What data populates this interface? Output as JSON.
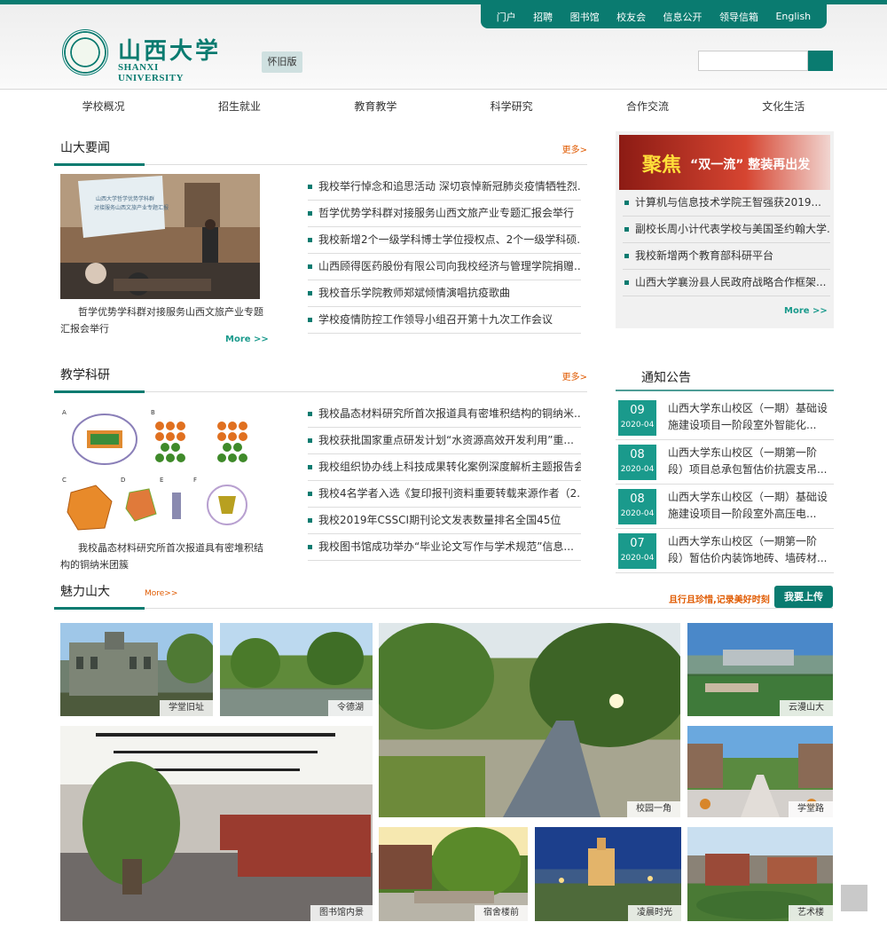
{
  "header": {
    "top_links": [
      "门户",
      "招聘",
      "图书馆",
      "校友会",
      "信息公开",
      "领导信箱",
      "English"
    ],
    "logo_cn": "山西大学",
    "logo_en": "SHANXI UNIVERSITY",
    "old_version": "怀旧版",
    "search_placeholder": ""
  },
  "nav": [
    "学校概况",
    "招生就业",
    "教育教学",
    "科学研究",
    "合作交流",
    "文化生活"
  ],
  "news": {
    "title": "山大要闻",
    "more": "更多>",
    "feature_caption": "哲学优势学科群对接服务山西文旅产业专题汇报会举行",
    "feature_more": "More >>",
    "items": [
      "我校举行悼念和追思活动 深切哀悼新冠肺炎疫情牺牲烈...",
      "哲学优势学科群对接服务山西文旅产业专题汇报会举行",
      "我校新增2个一级学科博士学位授权点、2个一级学科硕...",
      "山西顾得医药股份有限公司向我校经济与管理学院捐赠...",
      "我校音乐学院教师郑斌倾情演唱抗疫歌曲",
      "学校疫情防控工作领导小组召开第十九次工作会议"
    ]
  },
  "banner": {
    "big": "聚焦",
    "small": "“双一流” 整装再出发"
  },
  "right_news": {
    "items": [
      "计算机与信息技术学院王智强获2019...",
      "副校长周小计代表学校与美国圣约翰大学...",
      "我校新增两个教育部科研平台",
      "山西大学襄汾县人民政府战略合作框架..."
    ],
    "more": "More >>"
  },
  "research": {
    "title": "教学科研",
    "more": "更多>",
    "feature_caption": "我校晶态材料研究所首次报道具有密堆积结构的铜纳米团簇",
    "items": [
      "我校晶态材料研究所首次报道具有密堆积结构的铜纳米...",
      "我校获批国家重点研发计划“水资源高效开发利用”重...",
      "我校组织协办线上科技成果转化案例深度解析主题报告会",
      "我校4名学者入选《复印报刊资料重要转载来源作者（2...",
      "我校2019年CSSCI期刊论文发表数量排名全国45位",
      "我校图书馆成功举办“毕业论文写作与学术规范”信息..."
    ]
  },
  "notices": {
    "title": "通知公告",
    "items": [
      {
        "day": "09",
        "month": "2020-04",
        "text": "山西大学东山校区（一期）基础设施建设项目一阶段室外智能化..."
      },
      {
        "day": "08",
        "month": "2020-04",
        "text": "山西大学东山校区（一期第一阶段）项目总承包暂估价抗震支吊..."
      },
      {
        "day": "08",
        "month": "2020-04",
        "text": "山西大学东山校区（一期）基础设施建设项目一阶段室外高压电..."
      },
      {
        "day": "07",
        "month": "2020-04",
        "text": "山西大学东山校区（一期第一阶段）暂估价内装饰地砖、墙砖材..."
      }
    ]
  },
  "charm": {
    "title": "魅力山大",
    "more": "More>>",
    "tagline": "且行且珍惜,记录美好时刻",
    "upload": "我要上传",
    "photos": [
      "学堂旧址",
      "令德湖",
      "校园一角",
      "云漫山大",
      "图书馆内景",
      "学堂路",
      "宿舍楼前",
      "凌晨时光",
      "艺术楼"
    ]
  }
}
